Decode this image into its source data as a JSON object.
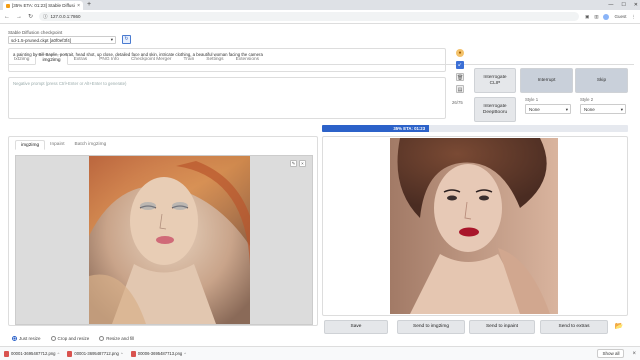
{
  "browser": {
    "tab_title": "[35% ETA: 01:23] Stable Diffusion",
    "url": "127.0.0.1:7860",
    "profile_label": "Guest",
    "new_tab_symbol": "+",
    "close_symbol": "×"
  },
  "checkpoint": {
    "label": "Stable Diffusion checkpoint",
    "value": "sd-1.5-pruned.ckpt [a0f0ef3f4]"
  },
  "main_tabs": [
    "txt2img",
    "img2img",
    "Extras",
    "PNG Info",
    "Checkpoint Merger",
    "Train",
    "Settings",
    "Extensions"
  ],
  "active_main_tab": "img2img",
  "prompt": {
    "text": "a painting by Bill Baplin, portrait, head shot, up close, detailed face and skin, intricate clothing, a beautiful woman facing the camera",
    "negative_placeholder": "Negative prompt (press Ctrl+Enter or Alt+Enter to generate)"
  },
  "token_count": "26/75",
  "buttons": {
    "interrogate_clip_1": "Interrogate",
    "interrogate_clip_2": "CLIP",
    "interrogate_deep_1": "Interrogate",
    "interrogate_deep_2": "DeepBooru",
    "interrupt": "Interrupt",
    "skip": "Skip",
    "save": "Save",
    "send_img2img": "Send to img2img",
    "send_inpaint": "Send to inpaint",
    "send_extras": "Send to extras"
  },
  "styles": {
    "style1_label": "Style 1",
    "style1_value": "None",
    "style2_label": "Style 2",
    "style2_value": "None"
  },
  "progress": {
    "text": "35% ETA: 01:23",
    "fraction": 0.35
  },
  "sub_tabs": [
    "img2img",
    "Inpaint",
    "Batch img2img"
  ],
  "active_sub_tab": "img2img",
  "resize_modes": [
    "Just resize",
    "Crop and resize",
    "Resize and fill"
  ],
  "active_resize_mode": "Just resize",
  "downloads": [
    "00001-3695487712.png",
    "00001-3695487712.png",
    "00006-3695487713.png"
  ],
  "show_all": "Show all",
  "colors": {
    "accent": "#2c62c9",
    "interrupt_bg": "#c9d0da"
  }
}
